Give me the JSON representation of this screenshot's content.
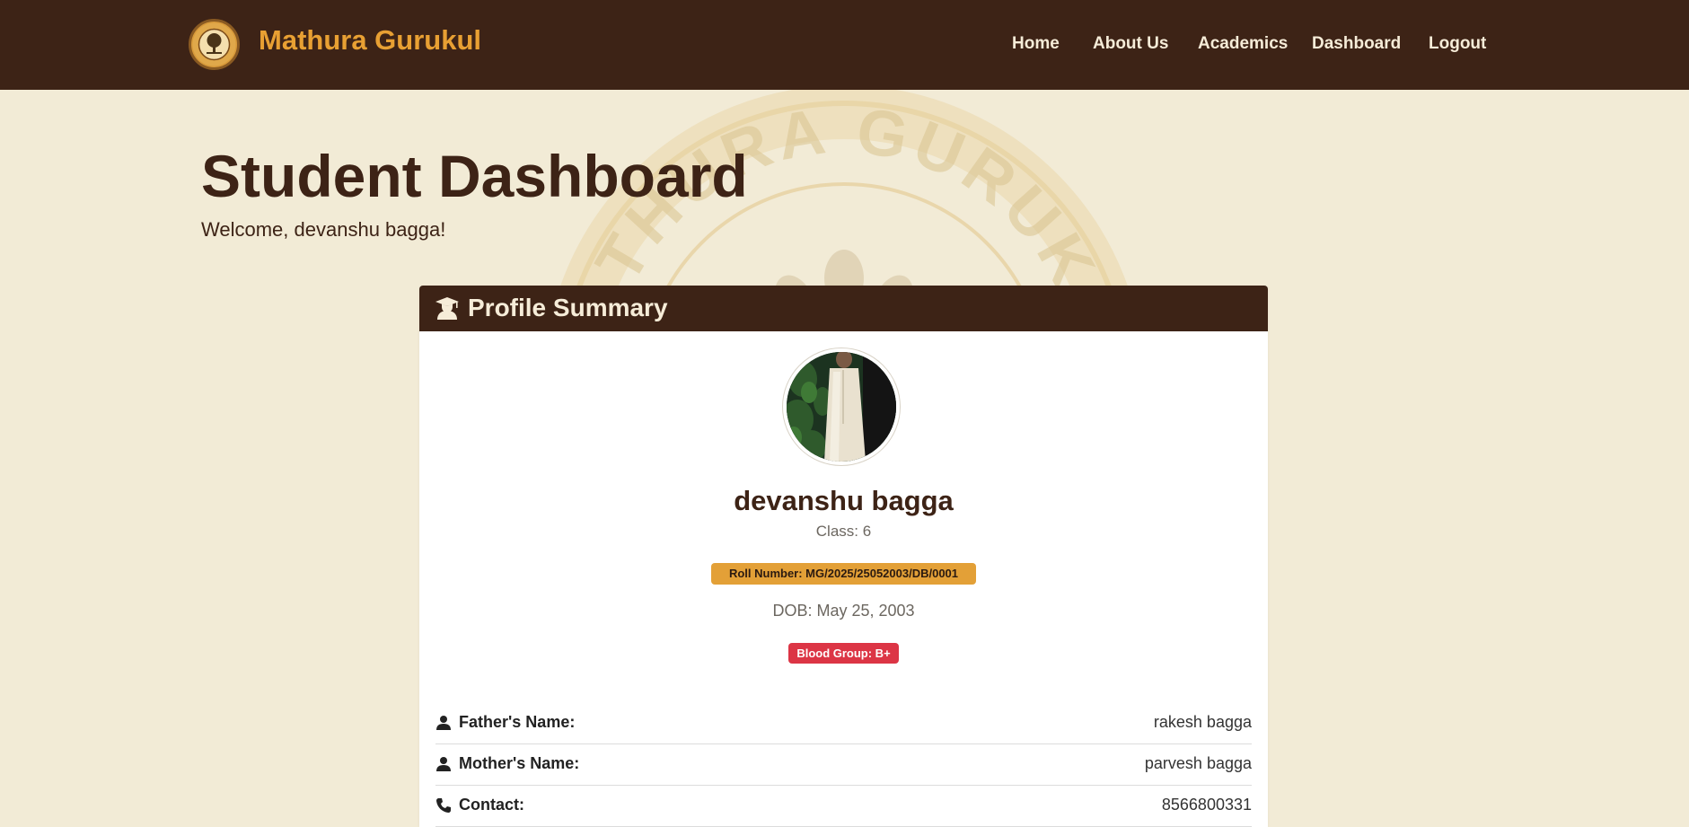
{
  "nav": {
    "brand": "Mathura Gurukul",
    "links": [
      "Home",
      "About Us",
      "Academics",
      "Dashboard",
      "Logout"
    ],
    "background": "#3d2316",
    "brand_color": "#e8a033"
  },
  "page": {
    "title": "Student Dashboard",
    "welcome": "Welcome, devanshu bagga!",
    "background": "#f2ebd6",
    "watermark_text": "MATHURA GURUKUL"
  },
  "profile": {
    "header_icon": "user-graduate-icon",
    "header": "Profile Summary",
    "name": "devanshu bagga",
    "class_label": "Class: 6",
    "roll_number": "Roll Number: MG/2025/25052003/DB/0001",
    "dob": "DOB: May 25, 2003",
    "blood_group": "Blood Group: B+",
    "rows": [
      {
        "icon": "user-icon",
        "label": "Father's Name:",
        "value": "rakesh bagga"
      },
      {
        "icon": "user-icon",
        "label": "Mother's Name:",
        "value": "parvesh bagga"
      },
      {
        "icon": "phone-icon",
        "label": "Contact:",
        "value": "8566800331"
      }
    ],
    "roll_badge_color": "#e3a037",
    "blood_badge_color": "#dc3545"
  }
}
